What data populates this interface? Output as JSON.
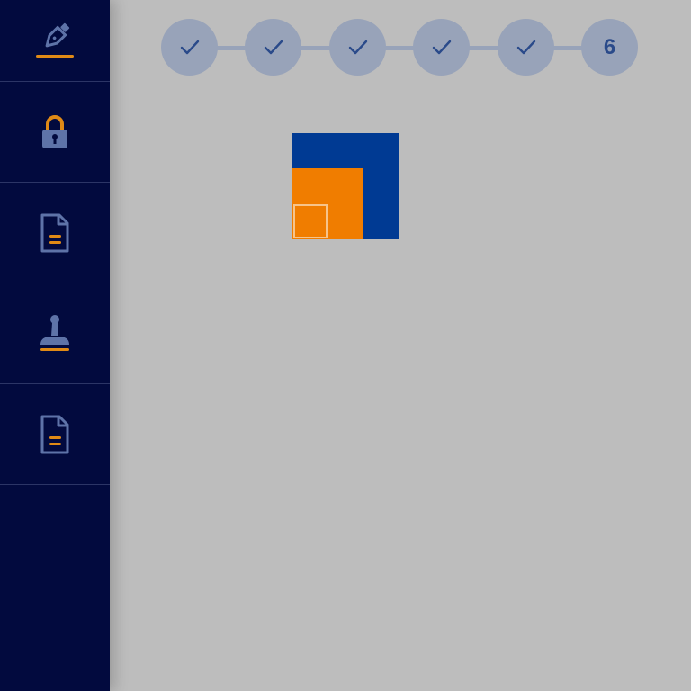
{
  "colors": {
    "sidebar_bg": "#020a3e",
    "icon_blue": "#5e73a8",
    "accent_orange": "#e08a16",
    "content_bg": "#bdbdbd",
    "step_circle": "#98a3b9",
    "step_text": "#2a4a8a",
    "logo_blue": "#003a93",
    "logo_orange": "#f07d00"
  },
  "sidebar": {
    "items": [
      {
        "icon": "pen-sign-icon",
        "active": true
      },
      {
        "icon": "lock-icon",
        "active": false
      },
      {
        "icon": "document-icon",
        "active": false
      },
      {
        "icon": "stamp-icon",
        "active": false
      },
      {
        "icon": "document-icon",
        "active": false
      }
    ]
  },
  "stepper": {
    "steps": [
      {
        "state": "complete",
        "icon": "check-icon"
      },
      {
        "state": "complete",
        "icon": "check-icon"
      },
      {
        "state": "complete",
        "icon": "check-icon"
      },
      {
        "state": "complete",
        "icon": "check-icon"
      },
      {
        "state": "complete",
        "icon": "check-icon"
      },
      {
        "state": "current",
        "label": "6"
      }
    ]
  },
  "logo": {
    "icon": "nested-squares-logo"
  }
}
